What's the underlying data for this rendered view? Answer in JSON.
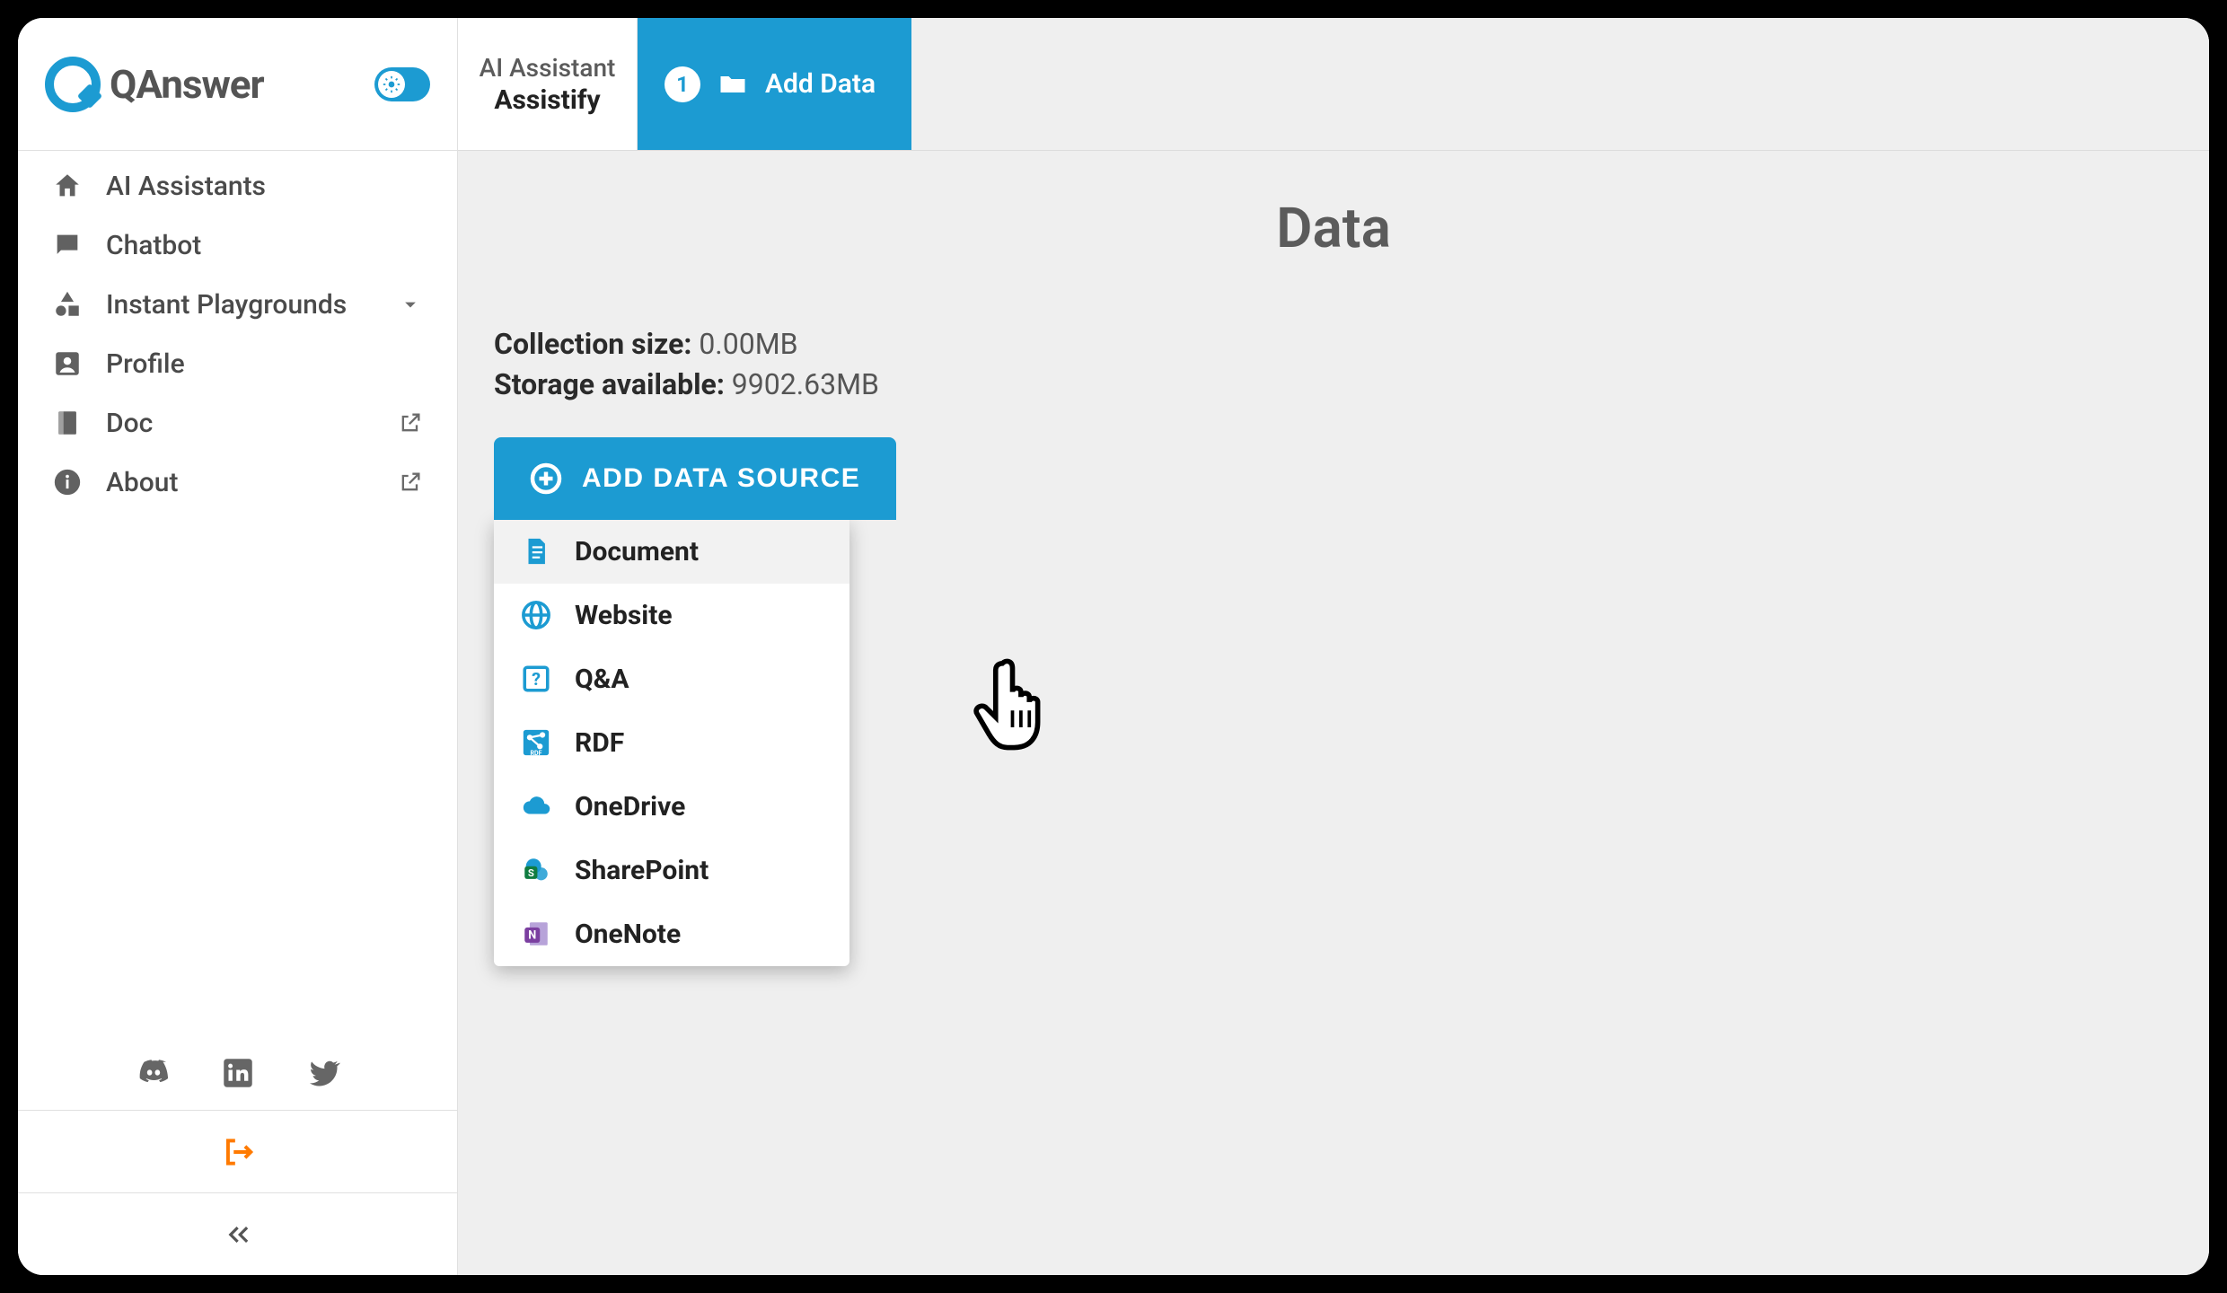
{
  "brand": {
    "name": "QAnswer"
  },
  "sidebar": {
    "items": [
      {
        "label": "AI Assistants"
      },
      {
        "label": "Chatbot"
      },
      {
        "label": "Instant Playgrounds"
      },
      {
        "label": "Profile"
      },
      {
        "label": "Doc"
      },
      {
        "label": "About"
      }
    ]
  },
  "topbar": {
    "assistant_label": "AI Assistant",
    "assistant_name": "Assistify",
    "step_number": "1",
    "step_label": "Add Data"
  },
  "page": {
    "title": "Data",
    "collection_size_label": "Collection size:",
    "collection_size_value": "0.00MB",
    "storage_label": "Storage available:",
    "storage_value": "9902.63MB",
    "add_button": "ADD DATA SOURCE"
  },
  "dropdown": {
    "items": [
      {
        "label": "Document",
        "icon": "document-icon"
      },
      {
        "label": "Website",
        "icon": "globe-icon"
      },
      {
        "label": "Q&A",
        "icon": "qa-icon"
      },
      {
        "label": "RDF",
        "icon": "rdf-icon"
      },
      {
        "label": "OneDrive",
        "icon": "cloud-icon"
      },
      {
        "label": "SharePoint",
        "icon": "sharepoint-icon"
      },
      {
        "label": "OneNote",
        "icon": "onenote-icon"
      }
    ]
  }
}
